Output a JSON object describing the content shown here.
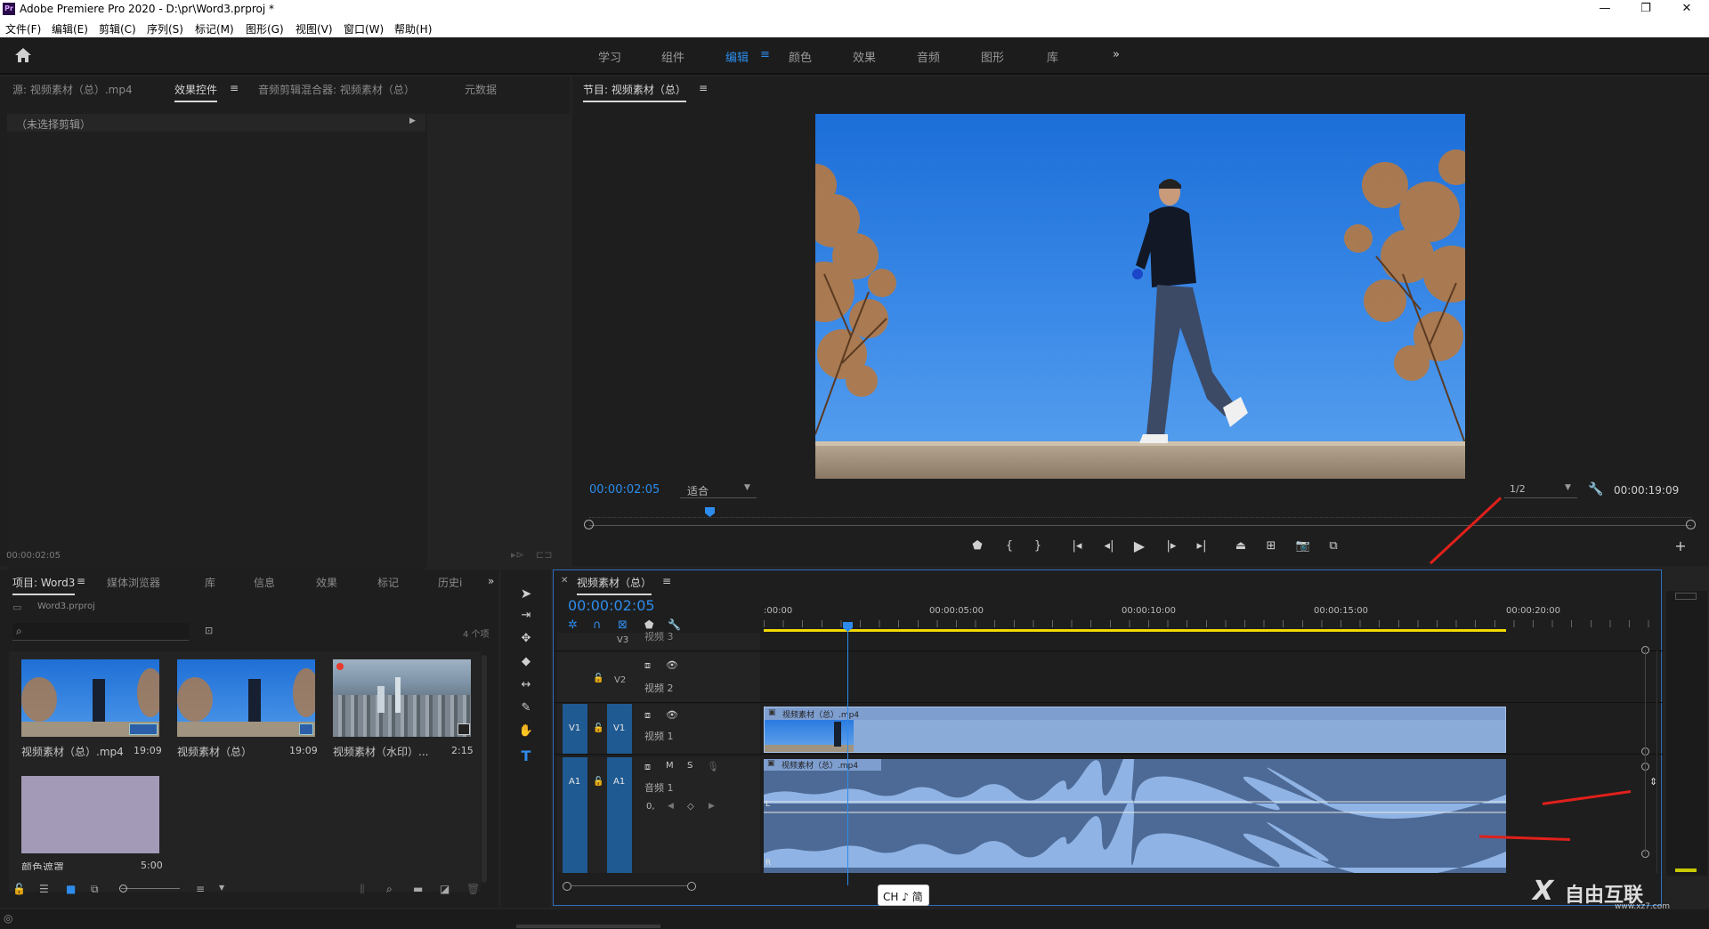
{
  "window": {
    "title": "Adobe Premiere Pro 2020 - D:\\pr\\Word3.prproj *",
    "app_icon": "Pr",
    "controls": [
      "—",
      "❐",
      "✕"
    ]
  },
  "menu": [
    "文件(F)",
    "编辑(E)",
    "剪辑(C)",
    "序列(S)",
    "标记(M)",
    "图形(G)",
    "视图(V)",
    "窗口(W)",
    "帮助(H)"
  ],
  "workspaces": {
    "items": [
      "学习",
      "组件",
      "编辑",
      "颜色",
      "效果",
      "音频",
      "图形",
      "库"
    ],
    "active": "编辑",
    "more": "»"
  },
  "source_panel": {
    "tabs": [
      "源: 视频素材（总）.mp4",
      "效果控件",
      "音频剪辑混合器: 视频素材（总）",
      "元数据"
    ],
    "active_tab": "效果控件",
    "no_clip": "（未选择剪辑）",
    "timecode": "00:00:02:05"
  },
  "program_monitor": {
    "title": "节目: 视频素材（总）",
    "timecode": "00:00:02:05",
    "fit": "适合",
    "resolution": "1/2",
    "duration": "00:00:19:09"
  },
  "project_panel": {
    "tabs": [
      "项目: Word3",
      "媒体浏览器",
      "库",
      "信息",
      "效果",
      "标记",
      "历史i"
    ],
    "active_tab": "项目: Word3",
    "file": "Word3.prproj",
    "item_count": "4 个项",
    "items": [
      {
        "label": "视频素材（总）.mp4",
        "duration": "19:09"
      },
      {
        "label": "视频素材（总）",
        "duration": "19:09"
      },
      {
        "label": "视频素材（水印）...",
        "duration": "2:15"
      },
      {
        "label": "颜色遮罩",
        "duration": "5:00"
      }
    ]
  },
  "timeline": {
    "sequence_tab": "视频素材（总）",
    "timecode": "00:00:02:05",
    "ruler": [
      ":00:00",
      "00:00:05:00",
      "00:00:10:00",
      "00:00:15:00",
      "00:00:20:00"
    ],
    "tracks": {
      "v3": {
        "id": "V3",
        "name": "视频 3"
      },
      "v2": {
        "id": "V2",
        "name": "视频 2"
      },
      "v1": {
        "src": "V1",
        "id": "V1",
        "name": "视频 1"
      },
      "a1": {
        "src": "A1",
        "id": "A1",
        "name": "音频 1",
        "m": "M",
        "s": "S"
      }
    },
    "video_clip": "视频素材（总）.mp4",
    "audio_clip": "视频素材（总）.mp4",
    "channels": [
      "L",
      "R"
    ],
    "vol": "0,"
  },
  "ime": "CH ♪ 简",
  "watermark": {
    "brand": "自由互联",
    "url": "www.xz7.com"
  }
}
